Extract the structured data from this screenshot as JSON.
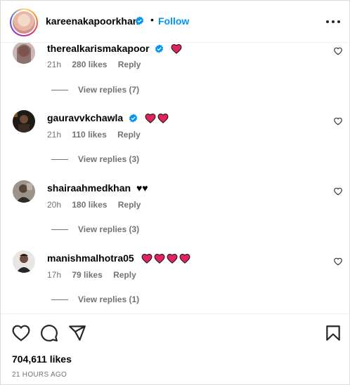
{
  "header": {
    "username": "kareenakapoorkhan",
    "separator": "•",
    "follow_label": "Follow"
  },
  "comments": [
    {
      "username": "therealkarismakapoor",
      "text": "",
      "hearts": 1,
      "time": "21h",
      "likes": "280 likes",
      "reply_label": "Reply",
      "view_replies": "View replies (7)"
    },
    {
      "username": "gauravvkchawla",
      "text": "",
      "hearts": 2,
      "time": "21h",
      "likes": "110 likes",
      "reply_label": "Reply",
      "view_replies": "View replies (3)"
    },
    {
      "username": "shairaahmedkhan",
      "text": "♥♥",
      "hearts": 0,
      "time": "20h",
      "likes": "180 likes",
      "reply_label": "Reply",
      "view_replies": "View replies (3)"
    },
    {
      "username": "manishmalhotra05",
      "text": "",
      "hearts": 4,
      "time": "17h",
      "likes": "79 likes",
      "reply_label": "Reply",
      "view_replies": "View replies (1)"
    }
  ],
  "footer": {
    "likes_total": "704,611 likes",
    "time_ago": "21 HOURS AGO"
  },
  "icons": {
    "verified": "verified-badge-icon",
    "more": "more-options-icon",
    "like": "heart-outline-icon",
    "comment": "comment-bubble-icon",
    "share": "paper-plane-icon",
    "save": "bookmark-icon",
    "red_heart": "red-heart-emoji"
  },
  "colors": {
    "accent": "#0095f6",
    "muted": "#737373",
    "heart": "#e0245e"
  }
}
